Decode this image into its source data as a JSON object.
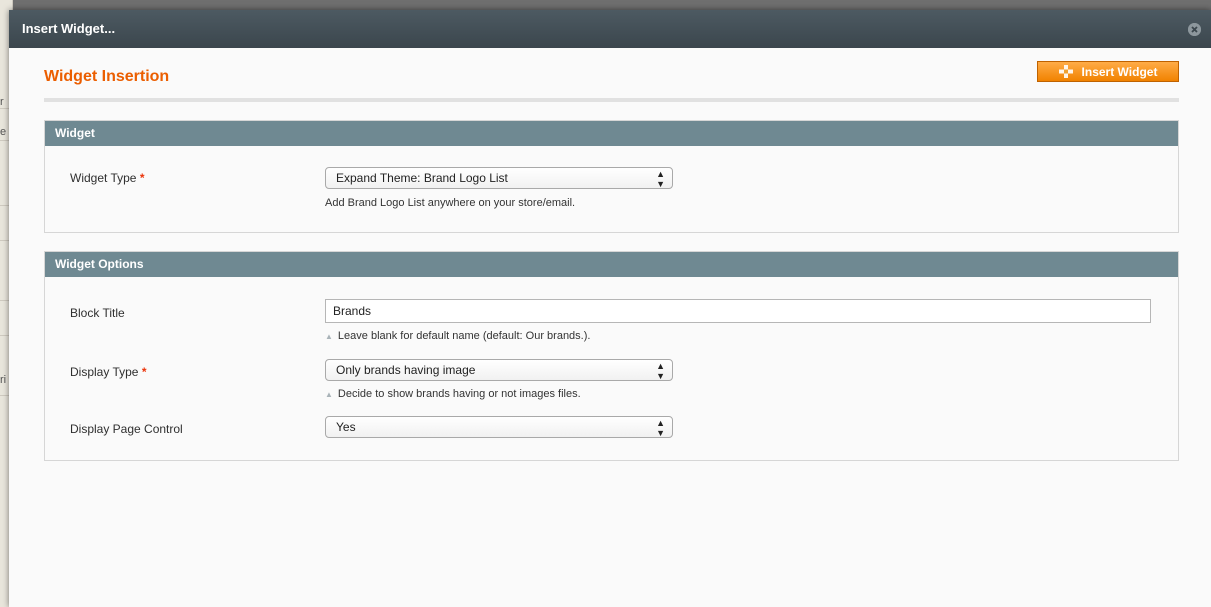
{
  "backdrop": {
    "fragments": [
      "r",
      "e",
      "ri"
    ]
  },
  "dialog": {
    "title": "Insert Widget...",
    "close_glyph": "⊗"
  },
  "header": {
    "title": "Widget Insertion",
    "insert_button_label": "Insert Widget"
  },
  "widget_section": {
    "title": "Widget",
    "widget_type": {
      "label": "Widget Type",
      "required_mark": "*",
      "value": "Expand Theme: Brand Logo List",
      "note": "Add Brand Logo List anywhere on your store/email."
    }
  },
  "options_section": {
    "title": "Widget Options",
    "block_title": {
      "label": "Block Title",
      "value": "Brands",
      "note": "Leave blank for default name (default: Our brands.)."
    },
    "display_type": {
      "label": "Display Type",
      "required_mark": "*",
      "value": "Only brands having image",
      "note": "Decide to show brands having or not images files."
    },
    "display_page_control": {
      "label": "Display Page Control",
      "value": "Yes"
    }
  },
  "colors": {
    "accent": "#eb5e00",
    "section_header": "#6f8992",
    "titlebar": "#3b464d",
    "button": "#f18200"
  }
}
